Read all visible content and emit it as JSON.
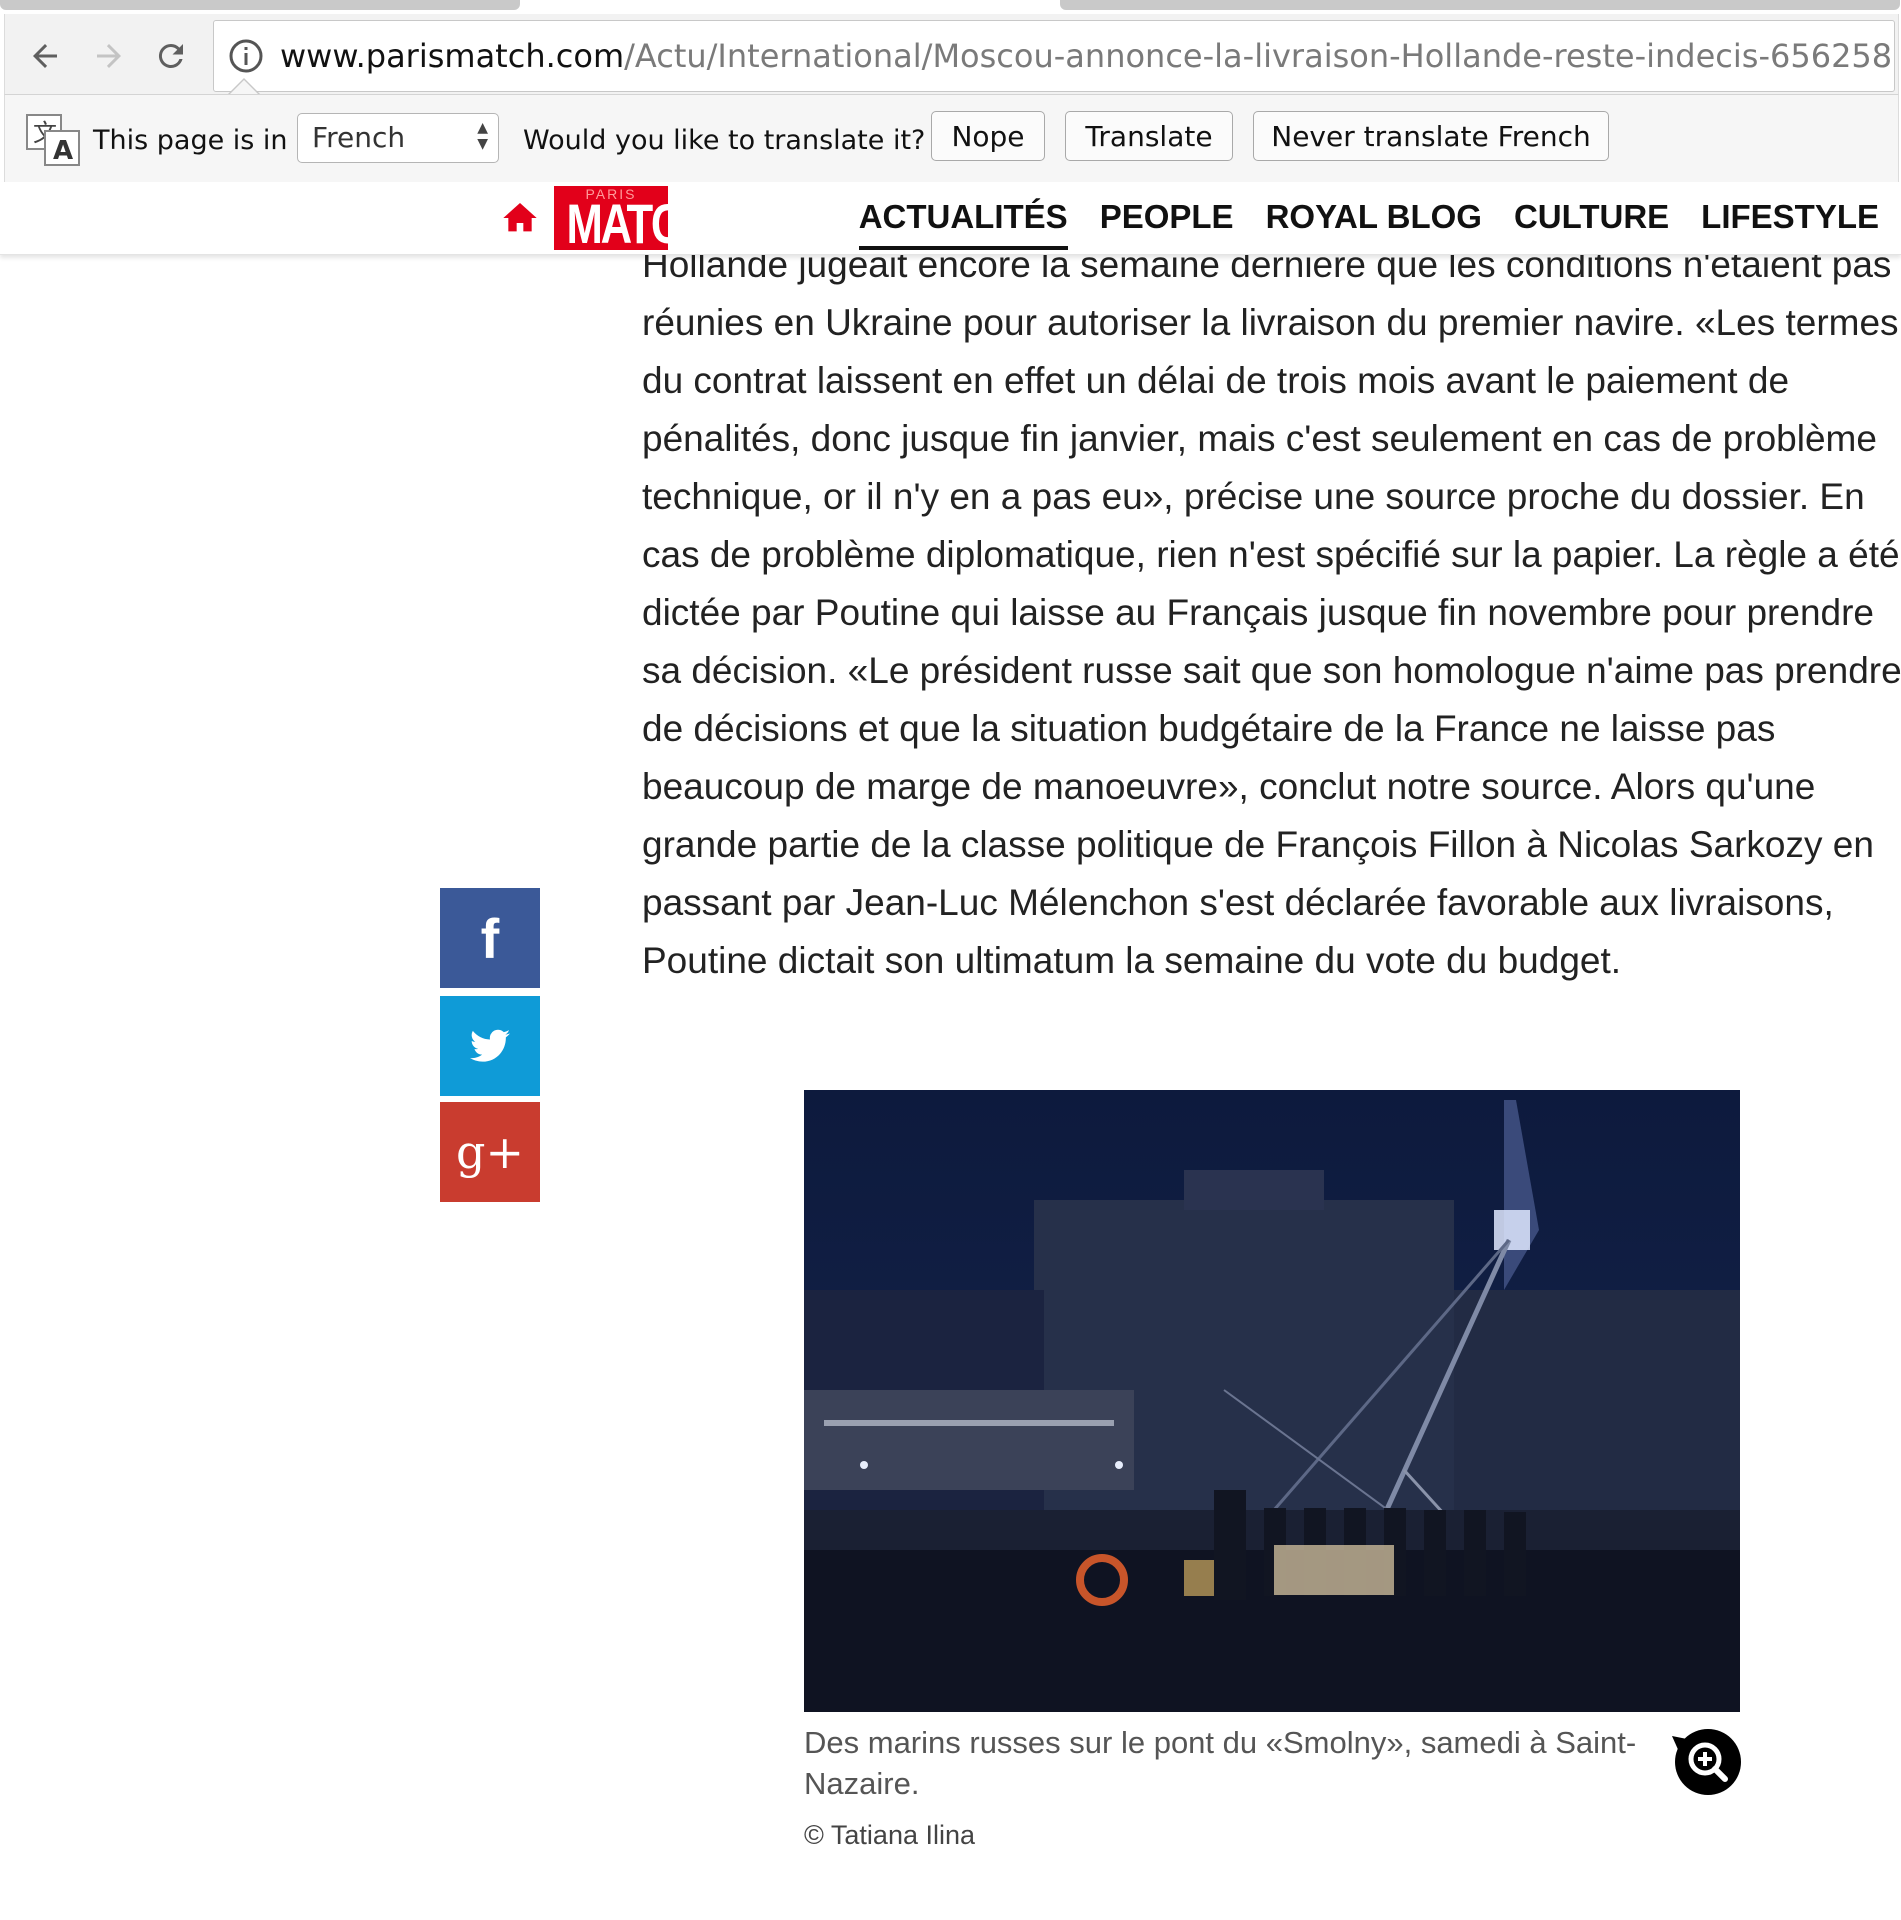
{
  "browser": {
    "url_host": "www.parismatch.com",
    "url_path": "/Actu/International/Moscou-annonce-la-livraison-Hollande-reste-indecis-656258",
    "icons": {
      "back": "back-arrow-icon",
      "forward": "forward-arrow-icon",
      "reload": "reload-icon",
      "info": "info-icon"
    }
  },
  "translate_bar": {
    "prefix": "This page is in",
    "language": "French",
    "question": "Would you like to translate it?",
    "nope": "Nope",
    "translate": "Translate",
    "never": "Never translate French"
  },
  "site": {
    "logo_top": "PARIS",
    "logo_main": "MATCH",
    "brand_color": "#e2001a",
    "menu": [
      "ACTUALITÉS",
      "PEOPLE",
      "ROYAL BLOG",
      "CULTURE",
      "LIFESTYLE"
    ]
  },
  "share": {
    "facebook": "f",
    "twitter": "twitter-bird-icon",
    "googleplus": "g+"
  },
  "article": {
    "paragraph": "Hollande jugeait encore la semaine dernière que les conditions n'étaient pas réunies en Ukraine pour autoriser la livraison du premier navire. «Les termes du contrat laissent en effet un délai de trois mois avant le paiement de pénalités, donc jusque fin janvier, mais c'est seulement en cas de problème technique, or il n'y en a pas eu», précise une source proche du dossier. En cas de problème diplomatique, rien n'est spécifié sur la papier. La règle a été dictée par Poutine qui laisse au Français jusque fin novembre pour prendre sa décision. «Le président russe sait que son homologue n'aime pas prendre de décisions et que la situation budgétaire de la France ne laisse pas beaucoup de marge de manoeuvre», conclut notre source. Alors qu'une grande partie de la classe politique de François Fillon à Nicolas Sarkozy en passant par Jean-Luc Mélenchon s'est déclarée favorable aux livraisons, Poutine dictait son ultimatum la semaine du vote du budget.",
    "caption": "Des marins russes sur le pont du «Smolny», samedi à Saint-Nazaire.",
    "credit": "© Tatiana Ilina"
  }
}
